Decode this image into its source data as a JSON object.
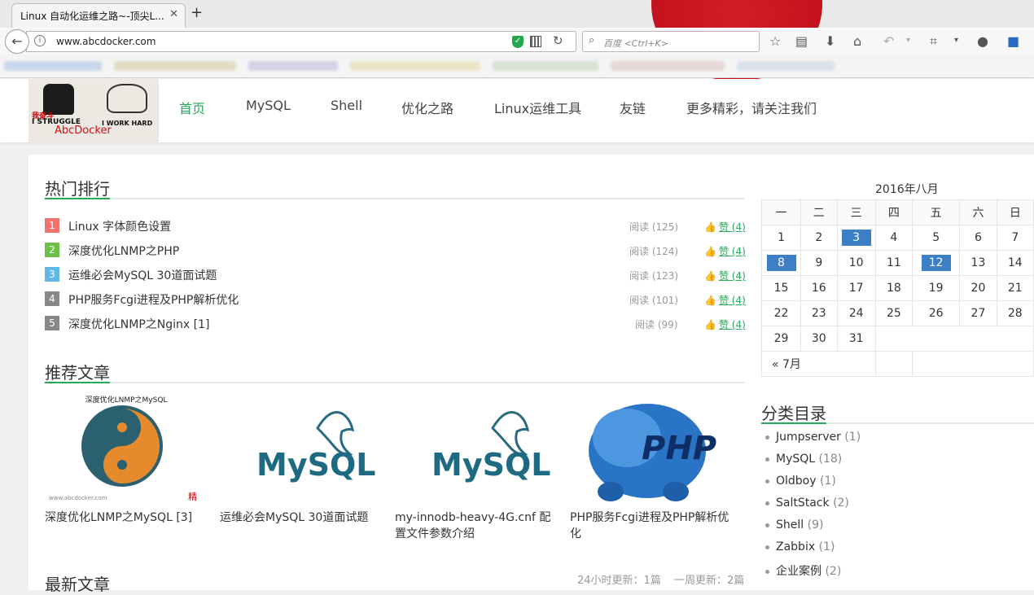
{
  "browser": {
    "tab_title": "Linux 自动化运维之路~-顶尖L...",
    "tab_close": "✕",
    "new_tab": "+",
    "url": "www.abcdocker.com",
    "search_placeholder": "百度 <Ctrl+K>"
  },
  "site": {
    "logo": {
      "label_red": "我奋斗",
      "struggle": "I STRUGGLE",
      "work_hard": "I WORK HARD",
      "name": "AbcDocker"
    },
    "nav": [
      {
        "label": "首页",
        "active": true
      },
      {
        "label": "MySQL"
      },
      {
        "label": "Shell"
      },
      {
        "label": "优化之路"
      },
      {
        "label": "Linux运维工具"
      },
      {
        "label": "友链"
      },
      {
        "label": "更多精彩，请关注我们"
      }
    ]
  },
  "hot": {
    "title": "热门排行",
    "items": [
      {
        "rank": "1",
        "color": "#f0736e",
        "title": "Linux 字体颜色设置",
        "reads": "阅读 (125)",
        "likes": "赞 (4)"
      },
      {
        "rank": "2",
        "color": "#6cc04a",
        "title": "深度优化LNMP之PHP",
        "reads": "阅读 (124)",
        "likes": "赞 (4)"
      },
      {
        "rank": "3",
        "color": "#5fb8e8",
        "title": "运维必会MySQL 30道面试题",
        "reads": "阅读 (123)",
        "likes": "赞 (4)"
      },
      {
        "rank": "4",
        "color": "#888888",
        "title": "PHP服务Fcgi进程及PHP解析优化",
        "reads": "阅读 (101)",
        "likes": "赞 (4)"
      },
      {
        "rank": "5",
        "color": "#888888",
        "title": "深度优化LNMP之Nginx [1]",
        "reads": "阅读 (99)",
        "likes": "赞 (4)"
      }
    ]
  },
  "recommend": {
    "title": "推荐文章",
    "items": [
      {
        "caption": "深度优化LNMP之MySQL [3]",
        "thumb_text": "深度优化LNMP之MySQL",
        "watermark": "www.abcdocker.com",
        "seal": "精"
      },
      {
        "caption": "运维必会MySQL 30道面试题",
        "thumb_text": "MySQL"
      },
      {
        "caption": "my-innodb-heavy-4G.cnf 配置文件参数介绍",
        "thumb_text": "MySQL"
      },
      {
        "caption": "PHP服务Fcgi进程及PHP解析优化",
        "thumb_text": "PHP"
      }
    ]
  },
  "latest": {
    "title": "最新文章",
    "updates_24h": "24小时更新：1篇",
    "updates_week": "一周更新：2篇"
  },
  "calendar": {
    "title": "2016年八月",
    "weekdays": [
      "一",
      "二",
      "三",
      "四",
      "五",
      "六",
      "日"
    ],
    "weeks": [
      [
        "1",
        "2",
        "3",
        "4",
        "5",
        "6",
        "7"
      ],
      [
        "8",
        "9",
        "10",
        "11",
        "12",
        "13",
        "14"
      ],
      [
        "15",
        "16",
        "17",
        "18",
        "19",
        "20",
        "21"
      ],
      [
        "22",
        "23",
        "24",
        "25",
        "26",
        "27",
        "28"
      ],
      [
        "29",
        "30",
        "31",
        "",
        "",
        "",
        ""
      ]
    ],
    "highlighted": [
      "3",
      "8",
      "12"
    ],
    "prev_link": "« 7月"
  },
  "categories": {
    "title": "分类目录",
    "items": [
      {
        "name": "Jumpserver",
        "count": "(1)"
      },
      {
        "name": "MySQL",
        "count": "(18)"
      },
      {
        "name": "Oldboy",
        "count": "(1)"
      },
      {
        "name": "SaltStack",
        "count": "(2)"
      },
      {
        "name": "Shell",
        "count": "(9)"
      },
      {
        "name": "Zabbix",
        "count": "(1)"
      },
      {
        "name": "企业案例",
        "count": "(2)"
      }
    ]
  }
}
